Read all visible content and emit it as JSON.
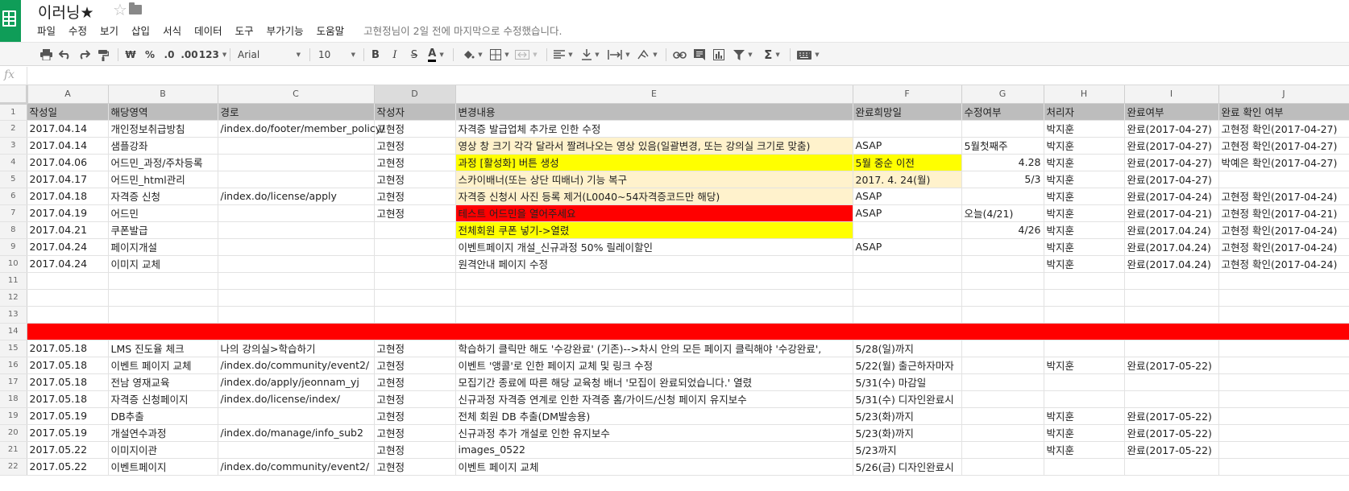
{
  "app": {
    "title": "이러닝★",
    "menu": [
      "파일",
      "수정",
      "보기",
      "삽입",
      "서식",
      "데이터",
      "도구",
      "부가기능",
      "도움말"
    ],
    "last_edit": "고현정님이 2일 전에 마지막으로 수정했습니다."
  },
  "toolbar": {
    "currency_symbol": "₩",
    "percent_symbol": "%",
    "decrease_decimal": ".0",
    "increase_decimal": ".00",
    "more_formats": "123",
    "font_name": "Arial",
    "font_size": "10",
    "bold": "B",
    "italic": "I",
    "strikethrough": "S",
    "text_color_glyph": "A",
    "sum_glyph": "Σ",
    "icons": [
      "print-icon",
      "undo-icon",
      "redo-icon",
      "paint-format-icon",
      "fill-color-icon",
      "borders-icon",
      "merge-cells-icon",
      "align-left-icon",
      "valign-bottom-icon",
      "text-wrap-icon",
      "text-rotate-icon",
      "link-icon",
      "comment-icon",
      "chart-icon",
      "filter-icon",
      "functions-icon",
      "input-tools-icon"
    ]
  },
  "formula_bar": {
    "fx_label": "fx",
    "value": ""
  },
  "grid": {
    "columns": [
      "A",
      "B",
      "C",
      "D",
      "E",
      "F",
      "G",
      "H",
      "I",
      "J"
    ],
    "selected_column": "D",
    "colors": {
      "header_bg": "#bdbdbd",
      "yellow": "#ffff00",
      "cream": "#fff2cc",
      "red": "#ff0000"
    },
    "header": [
      "작성일",
      "해당영역",
      "경로",
      "작성자",
      "변경내용",
      "완료희망일",
      "수정여부",
      "처리자",
      "완료여부",
      "완료 확인 여부"
    ],
    "rows": [
      {
        "n": "2",
        "cells": [
          "2017.04.14",
          "개인정보취급방침",
          "/index.do/footer/member_policy/",
          "고현정",
          "자격증 발급업체 추가로 인한 수정",
          "",
          "",
          "박지훈",
          "완료(2017-04-27)",
          "고현정 확인(2017-04-27)"
        ]
      },
      {
        "n": "3",
        "cells": [
          "2017.04.14",
          "샘플강좌",
          "",
          "고현정",
          "영상 창 크기 각각 달라서 짤려나오는 영상 있음(일괄변경, 또는 강의실 크기로 맞춤)",
          "ASAP",
          "5월첫째주",
          "박지훈",
          "완료(2017-04-27)",
          "고현정 확인(2017-04-27)"
        ],
        "e_bg": "cream"
      },
      {
        "n": "4",
        "cells": [
          "2017.04.06",
          "어드민_과정/주차등록",
          "",
          "고현정",
          "과정 [활성화] 버튼 생성",
          "5월 중순 이전",
          "4.28",
          "박지훈",
          "완료(2017-04-27)",
          "박예은 확인(2017-04-27)"
        ],
        "e_bg": "yellow",
        "f_bg": "yellow",
        "g_num": true
      },
      {
        "n": "5",
        "cells": [
          "2017.04.17",
          "어드민_html관리",
          "",
          "고현정",
          "스카이배너(또는 상단 띠배너) 기능 복구",
          "2017. 4. 24(월)",
          "5/3",
          "박지훈",
          "완료(2017-04-27)",
          ""
        ],
        "e_bg": "cream",
        "f_bg": "cream",
        "g_num": true
      },
      {
        "n": "6",
        "cells": [
          "2017.04.18",
          "자격증 신청",
          "/index.do/license/apply",
          "고현정",
          "자격증 신청시 사진 등록 제거(L0040~54자격증코드만 해당)",
          "ASAP",
          "",
          "박지훈",
          "완료(2017-04-24)",
          "고현정 확인(2017-04-24)"
        ],
        "e_bg": "cream"
      },
      {
        "n": "7",
        "cells": [
          "2017.04.19",
          "어드민",
          "",
          "고현정",
          "테스트 어드민을 열어주세요",
          "ASAP",
          "오늘(4/21)",
          "박지훈",
          "완료(2017-04-21)",
          "고현정 확인(2017-04-21)"
        ],
        "e_bg": "red"
      },
      {
        "n": "8",
        "cells": [
          "2017.04.21",
          "쿠폰발급",
          "",
          "",
          "전체회원 쿠폰 넣기->열렸",
          "",
          "4/26",
          "박지훈",
          "완료(2017.04.24)",
          "고현정 확인(2017-04-24)"
        ],
        "e_bg": "yellow",
        "g_num": true
      },
      {
        "n": "9",
        "cells": [
          "2017.04.24",
          "페이지개설",
          "",
          "",
          "이벤트페이지 개설_신규과정 50% 릴레이할인",
          "ASAP",
          "",
          "박지훈",
          "완료(2017.04.24)",
          "고현정 확인(2017-04-24)"
        ]
      },
      {
        "n": "10",
        "cells": [
          "2017.04.24",
          "이미지 교체",
          "",
          "",
          "원격안내 페이지 수정",
          "",
          "",
          "박지훈",
          "완료(2017.04.24)",
          "고현정 확인(2017-04-24)"
        ]
      },
      {
        "n": "11",
        "cells": [
          "",
          "",
          "",
          "",
          "",
          "",
          "",
          "",
          "",
          ""
        ]
      },
      {
        "n": "12",
        "cells": [
          "",
          "",
          "",
          "",
          "",
          "",
          "",
          "",
          "",
          ""
        ]
      },
      {
        "n": "13",
        "cells": [
          "",
          "",
          "",
          "",
          "",
          "",
          "",
          "",
          "",
          ""
        ]
      },
      {
        "n": "14",
        "cells": [
          "",
          "",
          "",
          "",
          "",
          "",
          "",
          "",
          "",
          ""
        ],
        "red_row": true
      },
      {
        "n": "15",
        "cells": [
          "2017.05.18",
          "LMS 진도율 체크",
          "나의 강의실>학습하기",
          "고현정",
          "학습하기 클릭만 해도 '수강완료' (기존)-->차시 안의 모든 페이지 클릭해야 '수강완료',",
          "5/28(일)까지",
          "",
          "",
          "",
          ""
        ]
      },
      {
        "n": "16",
        "cells": [
          "2017.05.18",
          "이벤트 페이지 교체",
          "/index.do/community/event2/",
          "고현정",
          "이벤트 '앵콜'로 인한 페이지 교체 및 링크 수정",
          "5/22(월) 출근하자마자",
          "",
          "박지훈",
          "완료(2017-05-22)",
          ""
        ]
      },
      {
        "n": "17",
        "cells": [
          "2017.05.18",
          "전남 영재교육",
          "/index.do/apply/jeonnam_yj",
          "고현정",
          "모집기간 종료에 따른 해당 교육청 배너 '모집이 완료되었습니다.' 열렸",
          "5/31(수) 마감일",
          "",
          "",
          "",
          ""
        ]
      },
      {
        "n": "18",
        "cells": [
          "2017.05.18",
          "자격증 신청페이지",
          "/index.do/license/index/",
          "고현정",
          "신규과정 자격증 연계로 인한 자격증 홈/가이드/신청 페이지 유지보수",
          "5/31(수) 디자인완료시",
          "",
          "",
          "",
          ""
        ]
      },
      {
        "n": "19",
        "cells": [
          "2017.05.19",
          "DB추출",
          "",
          "고현정",
          "전체 회원 DB 추출(DM발송용)",
          "5/23(화)까지",
          "",
          "박지훈",
          "완료(2017-05-22)",
          ""
        ]
      },
      {
        "n": "20",
        "cells": [
          "2017.05.19",
          "개설연수과정",
          "/index.do/manage/info_sub2",
          "고현정",
          "신규과정 추가 개설로 인한 유지보수",
          "5/23(화)까지",
          "",
          "박지훈",
          "완료(2017-05-22)",
          ""
        ]
      },
      {
        "n": "21",
        "cells": [
          "2017.05.22",
          "이미지이관",
          "",
          "고현정",
          "images_0522",
          "5/23까지",
          "",
          "박지훈",
          "완료(2017-05-22)",
          ""
        ]
      },
      {
        "n": "22",
        "cells": [
          "2017.05.22",
          "이벤트페이지",
          "/index.do/community/event2/",
          "고현정",
          "이벤트 페이지 교체",
          "5/26(금) 디자인완료시",
          "",
          "",
          "",
          ""
        ]
      }
    ]
  }
}
